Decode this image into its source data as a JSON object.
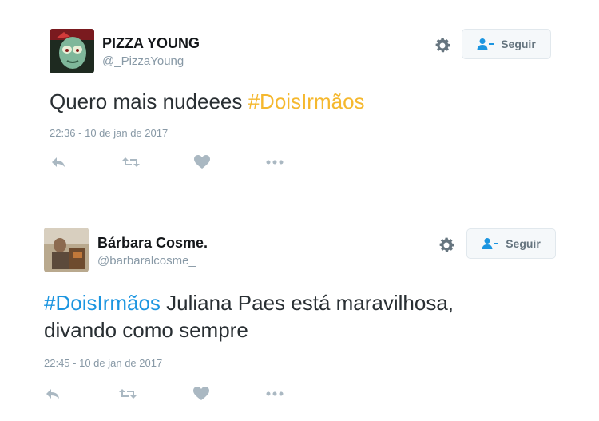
{
  "colors": {
    "hashtag_gold": "#f5b82e",
    "hashtag_blue": "#1b95e0",
    "muted": "#8899a6",
    "icon_gray": "#aab8c2"
  },
  "tweets": [
    {
      "name": "PIZZA YOUNG",
      "handle": "@_PizzaYoung",
      "text_before": "Quero mais nudeees ",
      "hashtag": "#DoisIrmãos",
      "text_after": "",
      "line2": "",
      "timestamp": "22:36 - 10 de jan de 2017",
      "follow_label": "Seguir",
      "icons": [
        "settings-gear-icon",
        "reply-icon",
        "retweet-icon",
        "like-heart-icon",
        "more-icon"
      ]
    },
    {
      "name": "Bárbara Cosme.",
      "handle": "@barbaralcosme_",
      "text_before": "",
      "hashtag": "#DoisIrmãos",
      "text_after": " Juliana Paes está maravilhosa,",
      "line2": "divando como sempre",
      "timestamp": "22:45 - 10 de jan de 2017",
      "follow_label": "Seguir",
      "icons": [
        "settings-gear-icon",
        "reply-icon",
        "retweet-icon",
        "like-heart-icon",
        "more-icon"
      ]
    }
  ]
}
